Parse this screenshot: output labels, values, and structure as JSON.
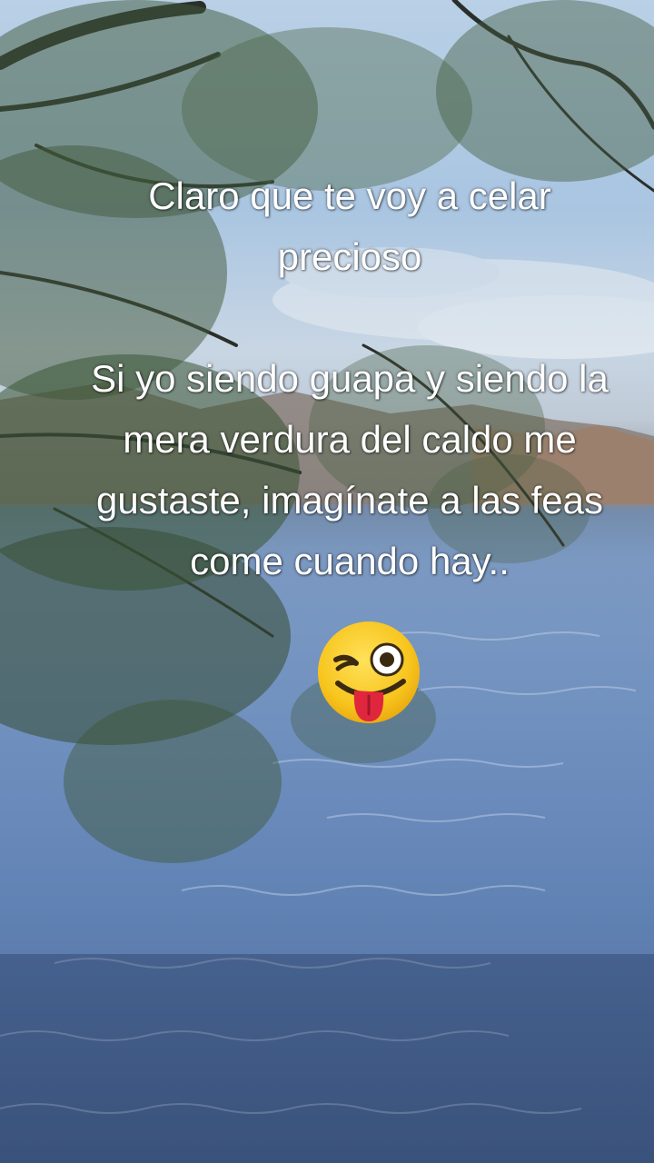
{
  "caption": {
    "line1": "Claro que te voy a celar",
    "line2": "precioso",
    "line3": "Si yo siendo guapa y siendo la",
    "line4": "mera verdura del caldo me",
    "line5": "gustaste, imagínate a las feas",
    "line6": "come cuando hay.."
  },
  "emoji": {
    "name": "winking-face-with-tongue",
    "face_color": "#f7c51e",
    "tongue_color": "#e0263d"
  },
  "colors": {
    "text": "#ffffff",
    "water": "#4f72a6",
    "sky": "#b9d0e6",
    "foliage": "#3f5a3c"
  }
}
